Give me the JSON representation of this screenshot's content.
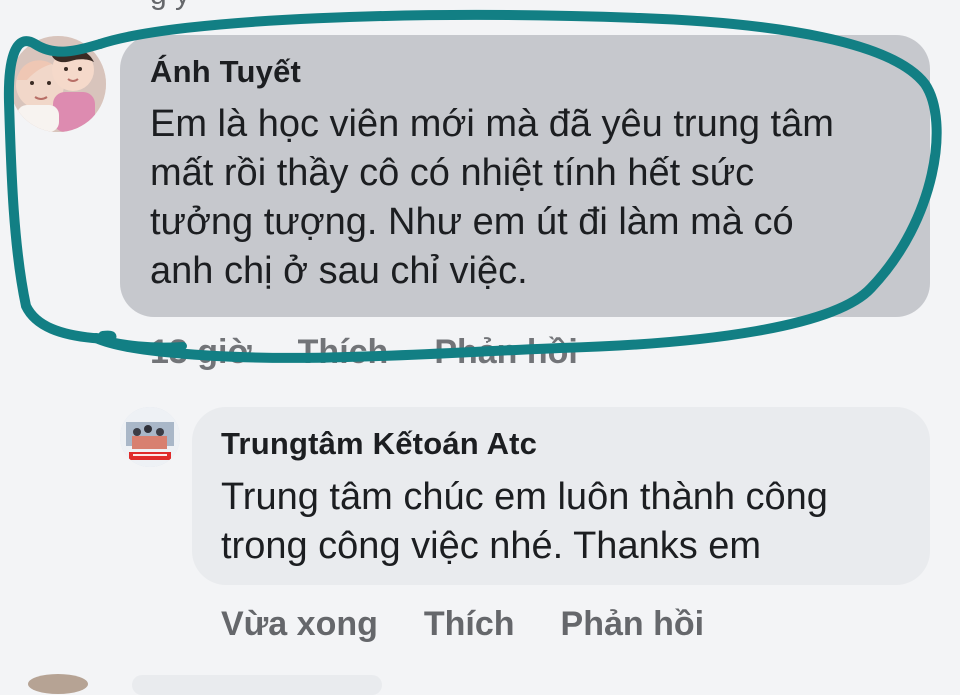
{
  "comments": [
    {
      "author": "Ánh Tuyết",
      "text": "Em là học viên mới mà đã yêu trung tâm\nmất rồi thầy cô có nhiệt tính hết sức\ntưởng tượng. Như em út đi làm mà có\nanh chị ở sau chỉ việc.",
      "time": "13 giờ",
      "like_label": "Thích",
      "reply_label": "Phản hồi"
    },
    {
      "author": "Trungtâm Kếtoán Atc",
      "text": "Trung tâm chúc em luôn thành công\ntrong công việc nhé. Thanks em",
      "time": "Vừa xong",
      "like_label": "Thích",
      "reply_label": "Phản hồi"
    }
  ],
  "colors": {
    "highlight_stroke": "#127f84",
    "bubble_highlighted": "#c6c8cd",
    "bubble_default": "#e9ebee",
    "meta_text": "#65676b"
  },
  "icons": {
    "comment_1_avatar": "profile-photo-children",
    "comment_2_avatar": "profile-photo-classroom"
  }
}
